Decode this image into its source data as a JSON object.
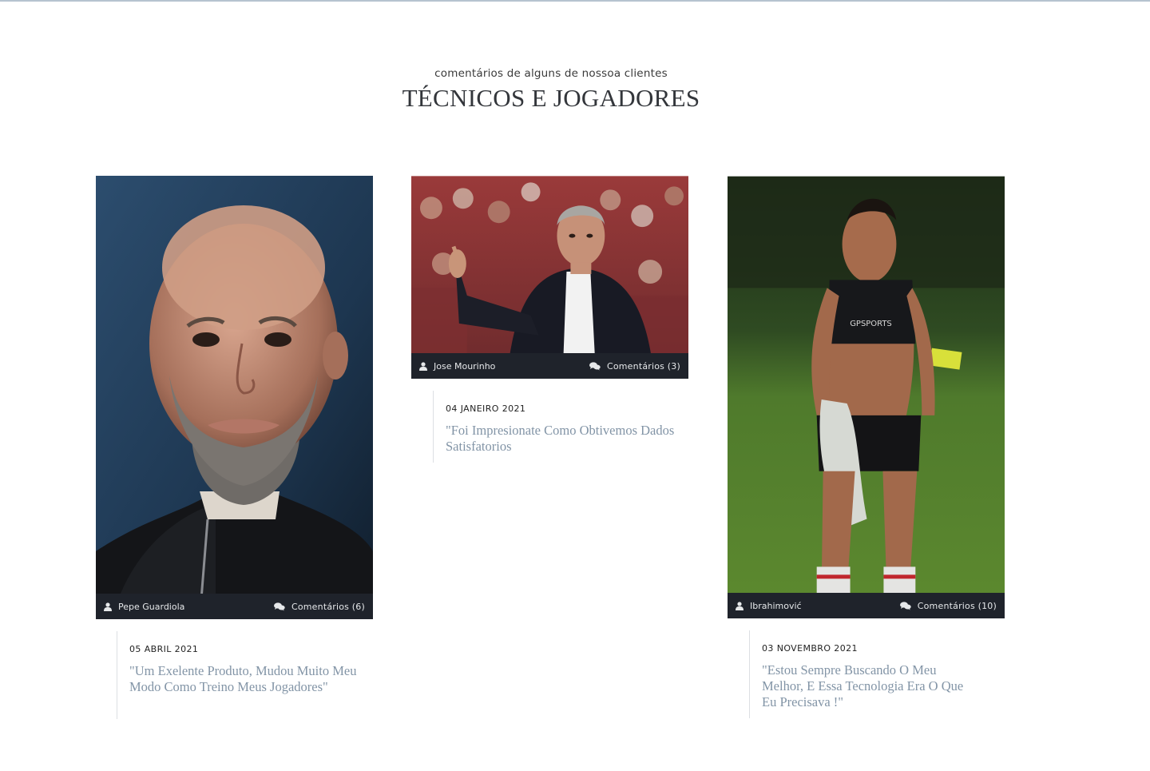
{
  "section": {
    "subtitle": "comentários de alguns de nossoa clientes",
    "title": "TÉCNICOS E JOGADORES"
  },
  "icons": {
    "author": "user-icon",
    "comments": "comments-icon"
  },
  "colors": {
    "meta_bar": "#1f232b",
    "quote": "#8294a6",
    "title": "#33363b"
  },
  "testimonials": [
    {
      "author": "Pepe Guardiola",
      "comments": "Comentários (6)",
      "date": "05 ABRIL 2021",
      "quote": "\"Um Exelente Produto, Mudou Muito Meu Modo Como Treino Meus Jogadores\""
    },
    {
      "author": "Jose Mourinho",
      "comments": "Comentários (3)",
      "date": "04 JANEIRO 2021",
      "quote": "\"Foi Impresionate Como Obtivemos Dados Satisfatorios"
    },
    {
      "author": "Ibrahimović",
      "comments": "Comentários (10)",
      "date": "03 NOVEMBRO 2021",
      "quote": "\"Estou Sempre Buscando O Meu Melhor, E Essa Tecnologia Era O Que Eu Precisava !\""
    }
  ]
}
